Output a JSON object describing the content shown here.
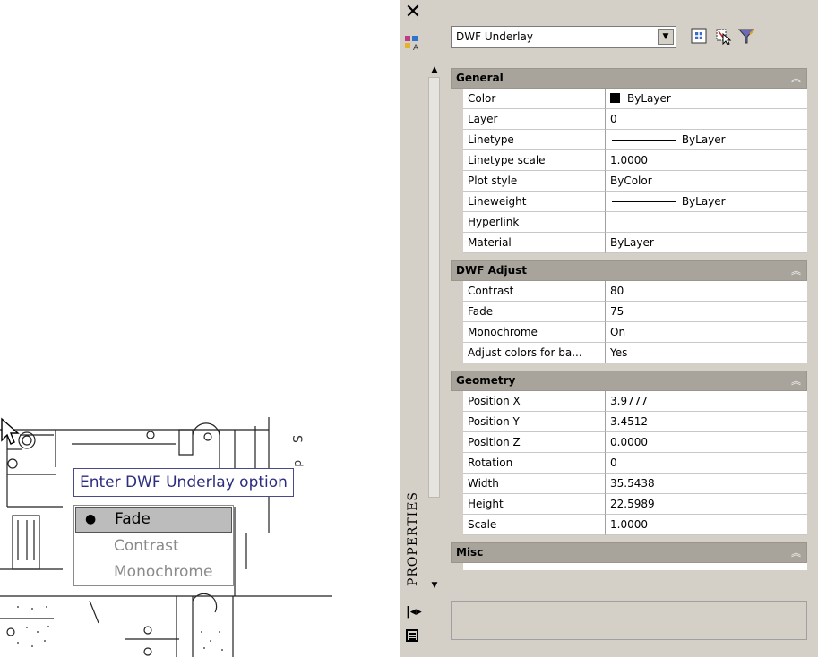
{
  "drawing": {
    "prompt": "Enter DWF Underlay option",
    "options": [
      "Fade",
      "Contrast",
      "Monochrome"
    ],
    "active_option": "Fade"
  },
  "palette": {
    "title": "PROPERTIES",
    "object_type": "DWF Underlay",
    "categories": [
      {
        "name": "General",
        "rows": [
          {
            "label": "Color",
            "value": "ByLayer"
          },
          {
            "label": "Layer",
            "value": "0"
          },
          {
            "label": "Linetype",
            "value": "ByLayer"
          },
          {
            "label": "Linetype scale",
            "value": "1.0000"
          },
          {
            "label": "Plot style",
            "value": "ByColor"
          },
          {
            "label": "Lineweight",
            "value": "ByLayer"
          },
          {
            "label": "Hyperlink",
            "value": ""
          },
          {
            "label": "Material",
            "value": "ByLayer"
          }
        ]
      },
      {
        "name": "DWF Adjust",
        "rows": [
          {
            "label": "Contrast",
            "value": "80"
          },
          {
            "label": "Fade",
            "value": "75"
          },
          {
            "label": "Monochrome",
            "value": "On"
          },
          {
            "label": "Adjust colors for ba...",
            "value": "Yes"
          }
        ]
      },
      {
        "name": "Geometry",
        "rows": [
          {
            "label": "Position X",
            "value": "3.9777"
          },
          {
            "label": "Position Y",
            "value": "3.4512"
          },
          {
            "label": "Position Z",
            "value": "0.0000"
          },
          {
            "label": "Rotation",
            "value": "0"
          },
          {
            "label": "Width",
            "value": "35.5438"
          },
          {
            "label": "Height",
            "value": "22.5989"
          },
          {
            "label": "Scale",
            "value": "1.0000"
          }
        ]
      },
      {
        "name": "Misc",
        "rows": []
      }
    ]
  },
  "icons": {
    "close": "close-icon",
    "quick_select": "quick-select-icon",
    "select_objects": "select-objects-icon",
    "toggle_pickadd": "toggle-pickadd-icon",
    "collapse": "chevron-up-double-icon",
    "auto_hide": "auto-hide-icon",
    "properties_menu": "properties-menu-icon"
  },
  "colors": {
    "category_header": "#a8a49c",
    "panel": "#d4d0c8",
    "prompt_text": "#2d2d80"
  }
}
